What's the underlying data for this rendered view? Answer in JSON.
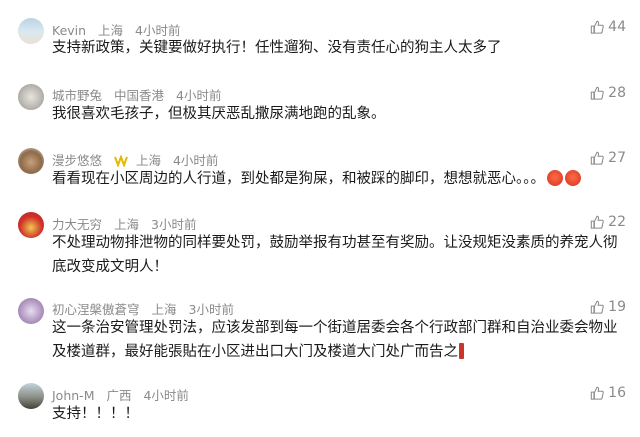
{
  "comments": [
    {
      "user": "Kevin",
      "location": "上海",
      "time": "4小时前",
      "text": "支持新政策，关键要做好执行！任性遛狗、没有责任心的狗主人太多了",
      "likes": "44"
    },
    {
      "user": "城市野兔",
      "location": "中国香港",
      "time": "4小时前",
      "text": "我很喜欢毛孩子，但极其厌恶乱撒尿满地跑的乱象。",
      "likes": "28"
    },
    {
      "user": "漫步悠悠",
      "location": "上海",
      "time": "4小时前",
      "text": "看看现在小区周边的人行道，到处都是狗屎，和被踩的脚印，想想就恶心。。。",
      "likes": "27"
    },
    {
      "user": "力大无穷",
      "location": "上海",
      "time": "3小时前",
      "text": "不处理动物排泄物的同样要处罚，鼓励举报有功甚至有奖励。让没规矩没素质的养宠人彻底改变成文明人！",
      "likes": "22"
    },
    {
      "user": "初心涅槃傲蒼穹",
      "location": "上海",
      "time": "3小时前",
      "text": "这一条治安管理处罚法，应该发部到每一个街道居委会各个行政部门群和自治业委会物业及楼道群，最好能張貼在小区进出口大门及楼道大门处广而告之",
      "likes": "19"
    },
    {
      "user": "John-M",
      "location": "广西",
      "time": "4小时前",
      "text": "支持！！！！",
      "likes": "16"
    }
  ]
}
